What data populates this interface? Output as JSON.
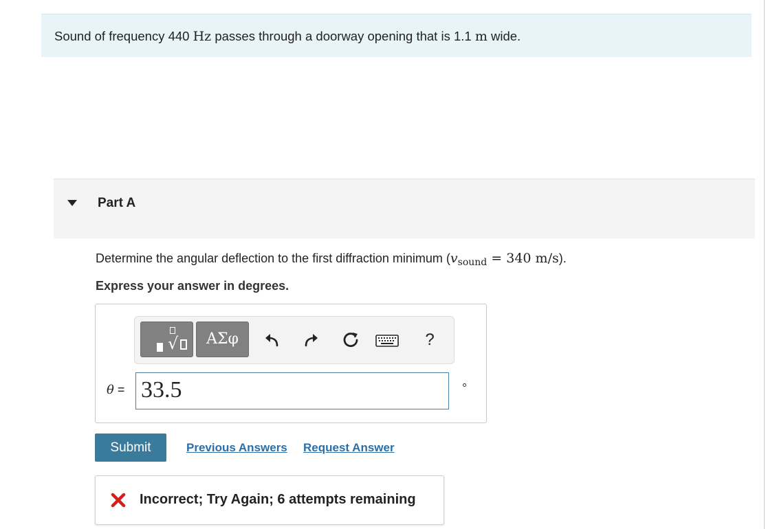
{
  "problem": {
    "text_before": "Sound of frequency 440 ",
    "frequency_unit": "Hz",
    "text_middle": " passes through a doorway opening that is 1.1 ",
    "width_unit": "m",
    "text_after": " wide."
  },
  "part": {
    "title": "Part A",
    "question_before": "Determine the angular deflection to the first diffraction minimum (",
    "v_symbol": "v",
    "v_subscript": "sound",
    "question_equals": " = 340 m/s",
    "question_after": ").",
    "instruction": "Express your answer in degrees."
  },
  "answer": {
    "variable": "θ",
    "equals": " =",
    "value": "33.5",
    "unit": "°"
  },
  "toolbar": {
    "greek_label": "ΑΣφ",
    "help_label": "?"
  },
  "actions": {
    "submit_label": "Submit",
    "previous_answers_label": "Previous Answers",
    "request_answer_label": "Request Answer"
  },
  "feedback": {
    "message": "Incorrect; Try Again; 6 attempts remaining",
    "status": "incorrect",
    "status_color": "#d0211c"
  }
}
